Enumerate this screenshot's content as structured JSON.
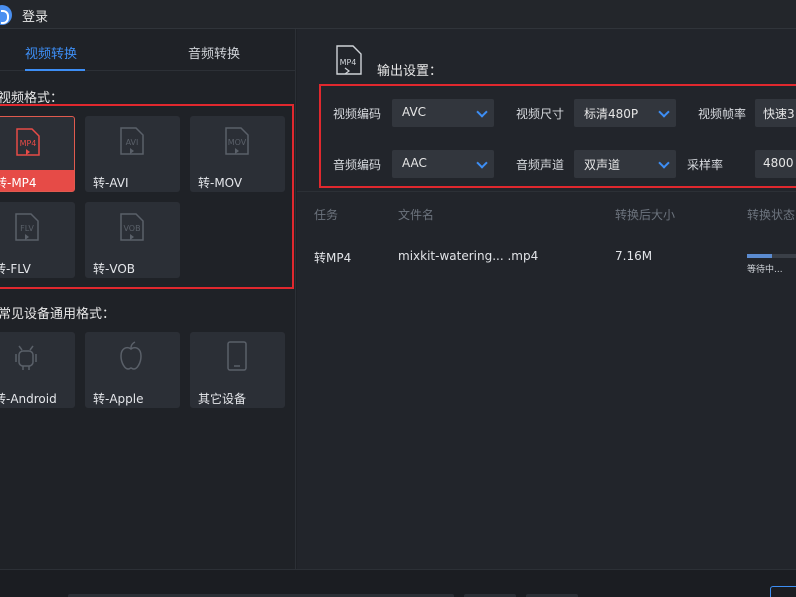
{
  "titlebar": {
    "title": "登录"
  },
  "tabs": [
    {
      "label": "视频转换",
      "active": true
    },
    {
      "label": "音频转换",
      "active": false
    }
  ],
  "video_section": {
    "title": "视频格式：",
    "formats": [
      {
        "label": "转-MP4",
        "icon_text": "MP4",
        "selected": true
      },
      {
        "label": "转-AVI",
        "icon_text": "AVI",
        "selected": false
      },
      {
        "label": "转-MOV",
        "icon_text": "MOV",
        "selected": false
      },
      {
        "label": "转-FLV",
        "icon_text": "FLV",
        "selected": false
      },
      {
        "label": "转-VOB",
        "icon_text": "VOB",
        "selected": false
      }
    ]
  },
  "device_section": {
    "title": "常见设备通用格式：",
    "devices": [
      {
        "label": "转-Android",
        "icon": "android-icon"
      },
      {
        "label": "转-Apple",
        "icon": "apple-icon"
      },
      {
        "label": "其它设备",
        "icon": "tablet-icon"
      }
    ]
  },
  "output": {
    "icon_text": "MP4",
    "title": "输出设置：",
    "video_codec": {
      "label": "视频编码",
      "value": "AVC"
    },
    "video_size": {
      "label": "视频尺寸",
      "value": "标清480P"
    },
    "frame_rate": {
      "label": "视频帧率",
      "value": "快速3"
    },
    "audio_codec": {
      "label": "音频编码",
      "value": "AAC"
    },
    "audio_channel": {
      "label": "音频声道",
      "value": "双声道"
    },
    "sample_rate": {
      "label": "采样率",
      "value": "4800"
    }
  },
  "table": {
    "headers": [
      "任务",
      "文件名",
      "转换后大小",
      "转换状态"
    ],
    "rows": [
      {
        "task": "转MP4",
        "filename": "mixkit-watering... .mp4",
        "size": "7.16M",
        "status": "等待中...",
        "progress": 0.5
      }
    ]
  },
  "colors": {
    "accent": "#3d8ef5",
    "highlight_red": "#e0282e",
    "selected_tile": "#e64b47"
  }
}
